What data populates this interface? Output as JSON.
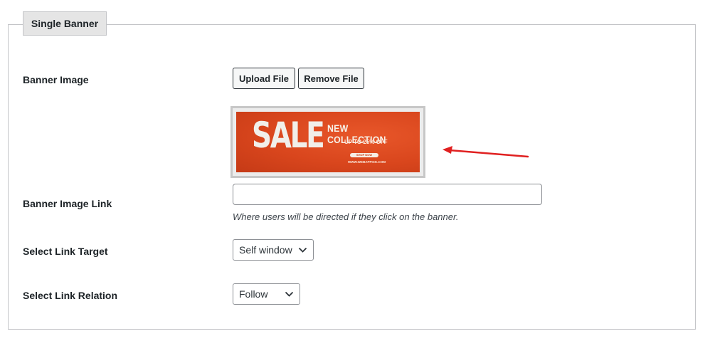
{
  "section": {
    "legend": "Single Banner"
  },
  "banner_image": {
    "label": "Banner Image",
    "upload_label": "Upload File",
    "remove_label": "Remove File",
    "preview": {
      "headline": "SALE",
      "title": "NEW COLLECTION",
      "subtitle": "UP TO 25% OFF",
      "button": "SHOP NOW",
      "site": "WWW.WEBAPPICK.COM"
    }
  },
  "banner_link": {
    "label": "Banner Image Link",
    "value": "",
    "placeholder": "",
    "description": "Where users will be directed if they click on the banner."
  },
  "link_target": {
    "label": "Select Link Target",
    "selected": "Self window"
  },
  "link_relation": {
    "label": "Select Link Relation",
    "selected": "Follow"
  },
  "colors": {
    "arrow": "#e02020",
    "banner_orange": "#d9461d",
    "legend_bg": "#e5e5e5"
  },
  "icons": [
    "arrow-annotation-icon",
    "chevron-down-icon"
  ]
}
